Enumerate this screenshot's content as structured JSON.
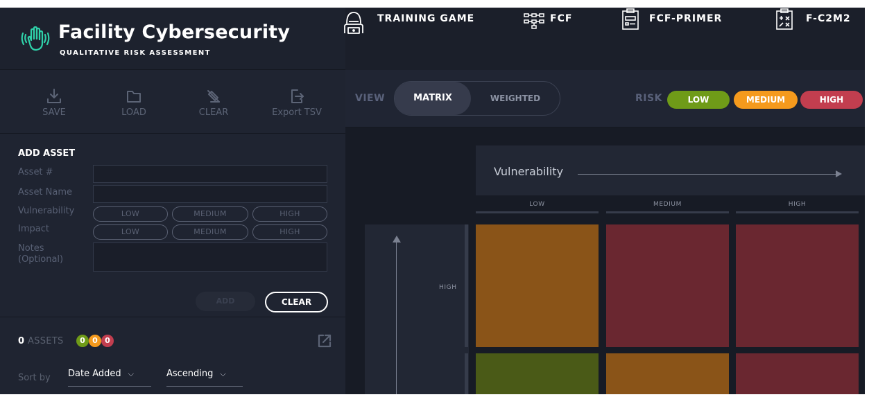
{
  "brand": {
    "title": "Facility Cybersecurity",
    "subtitle": "QUALITATIVE RISK ASSESSMENT",
    "icon": "hand-icon"
  },
  "nav": [
    {
      "label": "TRAINING GAME",
      "icon": "hacker-icon"
    },
    {
      "label": "FCF",
      "icon": "network-icon"
    },
    {
      "label": "FCF-PRIMER",
      "icon": "document-icon"
    },
    {
      "label": "F-C2M2",
      "icon": "clipboard-icon"
    }
  ],
  "toolbar": [
    {
      "label": "SAVE",
      "icon": "download-icon"
    },
    {
      "label": "LOAD",
      "icon": "folder-icon"
    },
    {
      "label": "CLEAR",
      "icon": "eraser-icon"
    },
    {
      "label": "Export TSV",
      "icon": "export-icon"
    }
  ],
  "form": {
    "title": "ADD ASSET",
    "asset_number_label": "Asset #",
    "asset_name_label": "Asset Name",
    "vulnerability_label": "Vulnerability",
    "impact_label": "Impact",
    "notes_label": "Notes (Optional)",
    "levels": [
      "LOW",
      "MEDIUM",
      "HIGH"
    ],
    "add_label": "ADD",
    "clear_label": "CLEAR"
  },
  "assets": {
    "count": "0",
    "label": "ASSETS",
    "low_count": "0",
    "medium_count": "0",
    "high_count": "0",
    "sort_label": "Sort by",
    "sort_field": "Date Added",
    "sort_order": "Ascending"
  },
  "view": {
    "label": "VIEW",
    "options": [
      "MATRIX",
      "WEIGHTED"
    ],
    "selected": "MATRIX"
  },
  "risk": {
    "label": "RISK",
    "levels": [
      "LOW",
      "MEDIUM",
      "HIGH"
    ]
  },
  "matrix": {
    "x_title": "Vulnerability",
    "columns": [
      "LOW",
      "MEDIUM",
      "HIGH"
    ],
    "row_label": "HIGH"
  },
  "colors": {
    "low": "#6f9b18",
    "medium": "#f59a1d",
    "high": "#c23e4f",
    "cell_medium": "#8a5418",
    "cell_high": "#6a2730",
    "cell_low": "#4a5a17"
  }
}
